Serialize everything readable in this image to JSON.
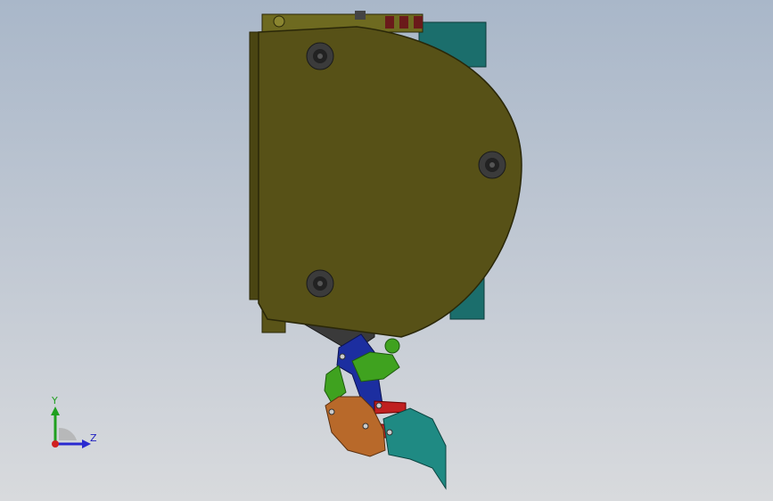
{
  "triad": {
    "y_label": "Y",
    "z_label": "Z",
    "colors": {
      "y_axis": "#1fa01f",
      "z_axis": "#2a2ad0",
      "x_axis": "#d02020"
    }
  },
  "model": {
    "colors": {
      "housing": "#575117",
      "housing_edge": "#2a2708",
      "top_plate": "#6e6a20",
      "teal_block": "#1b6e6c",
      "bolt": "#2a2a2a",
      "dark_rail": "#3a3a3a",
      "blue_link": "#1c2ea0",
      "green_link": "#3fa21f",
      "red_link": "#c02020",
      "orange_gear": "#b8692a",
      "teal_claw": "#1f8a83"
    }
  }
}
